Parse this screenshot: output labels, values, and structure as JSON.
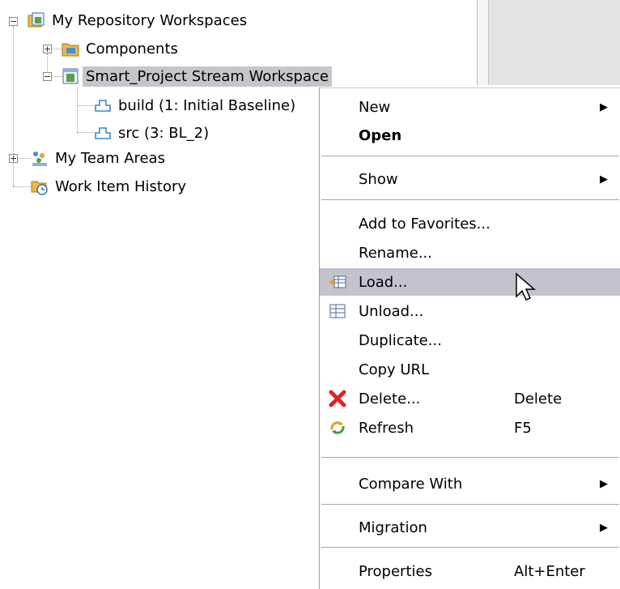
{
  "tree": {
    "workspaces_label": "My Repository Workspaces",
    "components_label": "Components",
    "workspace_label": "Smart_Project Stream Workspace",
    "build_label": "build (1: Initial Baseline)",
    "src_label": "src (3: BL_2)",
    "team_areas_label": "My Team Areas",
    "work_item_history_label": "Work Item History"
  },
  "context_menu": {
    "new": "New",
    "open": "Open",
    "show": "Show",
    "add_to_favorites": "Add to Favorites...",
    "rename": "Rename...",
    "load": "Load...",
    "unload": "Unload...",
    "duplicate": "Duplicate...",
    "copy_url": "Copy URL",
    "delete": "Delete...",
    "delete_accel": "Delete",
    "refresh": "Refresh",
    "refresh_accel": "F5",
    "compare_with": "Compare With",
    "migration": "Migration",
    "properties": "Properties",
    "properties_accel": "Alt+Enter"
  },
  "colors": {
    "selection": "#c5c5cc",
    "menu_highlight": "#c3c3cd",
    "delete_icon": "#d9262b",
    "folder_icon": "#e8b84a"
  },
  "icons": {
    "arrow": "▶"
  }
}
